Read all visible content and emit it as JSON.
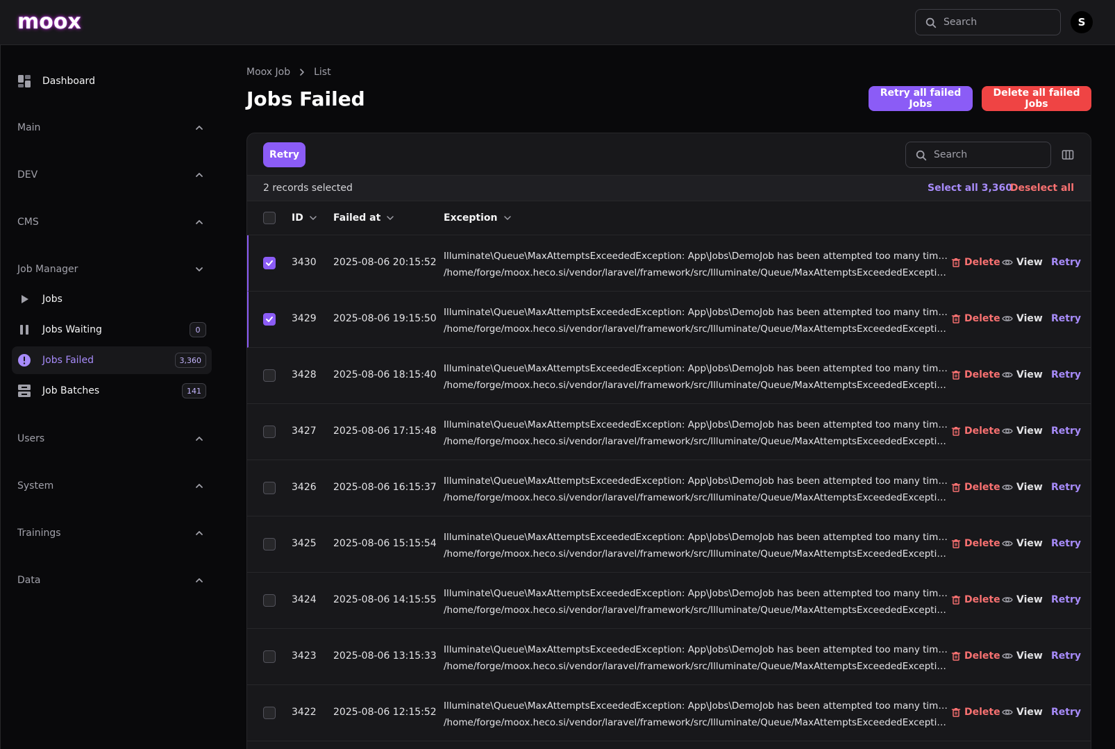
{
  "app": {
    "logo_text": "moox"
  },
  "topbar": {
    "search_placeholder": "Search",
    "avatar_initial": "S"
  },
  "sidebar": {
    "dashboard_label": "Dashboard",
    "groups": {
      "main": "Main",
      "dev": "DEV",
      "cms": "CMS",
      "job_manager": "Job Manager",
      "users": "Users",
      "system": "System",
      "trainings": "Trainings",
      "data": "Data"
    },
    "items": [
      {
        "label": "Jobs",
        "badge": ""
      },
      {
        "label": "Jobs Waiting",
        "badge": "0"
      },
      {
        "label": "Jobs Failed",
        "badge": "3,360"
      },
      {
        "label": "Job Batches",
        "badge": "141"
      }
    ]
  },
  "breadcrumb": {
    "parent": "Moox Job",
    "current": "List"
  },
  "page": {
    "title": "Jobs Failed",
    "retry_all_label": "Retry all failed Jobs",
    "delete_all_label": "Delete all failed Jobs"
  },
  "table": {
    "bulk_retry_label": "Retry",
    "search_placeholder": "Search",
    "selection": {
      "text": "2 records selected",
      "select_all": "Select all 3,360",
      "deselect_all": "Deselect all"
    },
    "columns": {
      "id": "ID",
      "failed_at": "Failed at",
      "exception": "Exception"
    },
    "actions": {
      "delete": "Delete",
      "view": "View",
      "retry": "Retry"
    },
    "rows": [
      {
        "id": "3430",
        "failed_at": "2025-08-06 20:15:52",
        "selected": true,
        "line1": "Illuminate\\Queue\\MaxAttemptsExceededException: App\\Jobs\\DemoJob has been attempted too many times. in",
        "line2": "/home/forge/moox.heco.si/vendor/laravel/framework/src/Illuminate/Queue/MaxAttemptsExceededExceptio..."
      },
      {
        "id": "3429",
        "failed_at": "2025-08-06 19:15:50",
        "selected": true,
        "line1": "Illuminate\\Queue\\MaxAttemptsExceededException: App\\Jobs\\DemoJob has been attempted too many times. in",
        "line2": "/home/forge/moox.heco.si/vendor/laravel/framework/src/Illuminate/Queue/MaxAttemptsExceededExceptio..."
      },
      {
        "id": "3428",
        "failed_at": "2025-08-06 18:15:40",
        "selected": false,
        "line1": "Illuminate\\Queue\\MaxAttemptsExceededException: App\\Jobs\\DemoJob has been attempted too many times. in",
        "line2": "/home/forge/moox.heco.si/vendor/laravel/framework/src/Illuminate/Queue/MaxAttemptsExceededExceptio..."
      },
      {
        "id": "3427",
        "failed_at": "2025-08-06 17:15:48",
        "selected": false,
        "line1": "Illuminate\\Queue\\MaxAttemptsExceededException: App\\Jobs\\DemoJob has been attempted too many times. in",
        "line2": "/home/forge/moox.heco.si/vendor/laravel/framework/src/Illuminate/Queue/MaxAttemptsExceededExceptio..."
      },
      {
        "id": "3426",
        "failed_at": "2025-08-06 16:15:37",
        "selected": false,
        "line1": "Illuminate\\Queue\\MaxAttemptsExceededException: App\\Jobs\\DemoJob has been attempted too many times. in",
        "line2": "/home/forge/moox.heco.si/vendor/laravel/framework/src/Illuminate/Queue/MaxAttemptsExceededExceptio..."
      },
      {
        "id": "3425",
        "failed_at": "2025-08-06 15:15:54",
        "selected": false,
        "line1": "Illuminate\\Queue\\MaxAttemptsExceededException: App\\Jobs\\DemoJob has been attempted too many times. in",
        "line2": "/home/forge/moox.heco.si/vendor/laravel/framework/src/Illuminate/Queue/MaxAttemptsExceededExceptio..."
      },
      {
        "id": "3424",
        "failed_at": "2025-08-06 14:15:55",
        "selected": false,
        "line1": "Illuminate\\Queue\\MaxAttemptsExceededException: App\\Jobs\\DemoJob has been attempted too many times. in",
        "line2": "/home/forge/moox.heco.si/vendor/laravel/framework/src/Illuminate/Queue/MaxAttemptsExceededExceptio..."
      },
      {
        "id": "3423",
        "failed_at": "2025-08-06 13:15:33",
        "selected": false,
        "line1": "Illuminate\\Queue\\MaxAttemptsExceededException: App\\Jobs\\DemoJob has been attempted too many times. in",
        "line2": "/home/forge/moox.heco.si/vendor/laravel/framework/src/Illuminate/Queue/MaxAttemptsExceededExceptio..."
      },
      {
        "id": "3422",
        "failed_at": "2025-08-06 12:15:52",
        "selected": false,
        "line1": "Illuminate\\Queue\\MaxAttemptsExceededException: App\\Jobs\\DemoJob has been attempted too many times. in",
        "line2": "/home/forge/moox.heco.si/vendor/laravel/framework/src/Illuminate/Queue/MaxAttemptsExceededExceptio..."
      }
    ]
  },
  "colors": {
    "accent": "#8b5cf6",
    "danger": "#ef4444",
    "background": "#09090b",
    "surface": "#18181b"
  }
}
